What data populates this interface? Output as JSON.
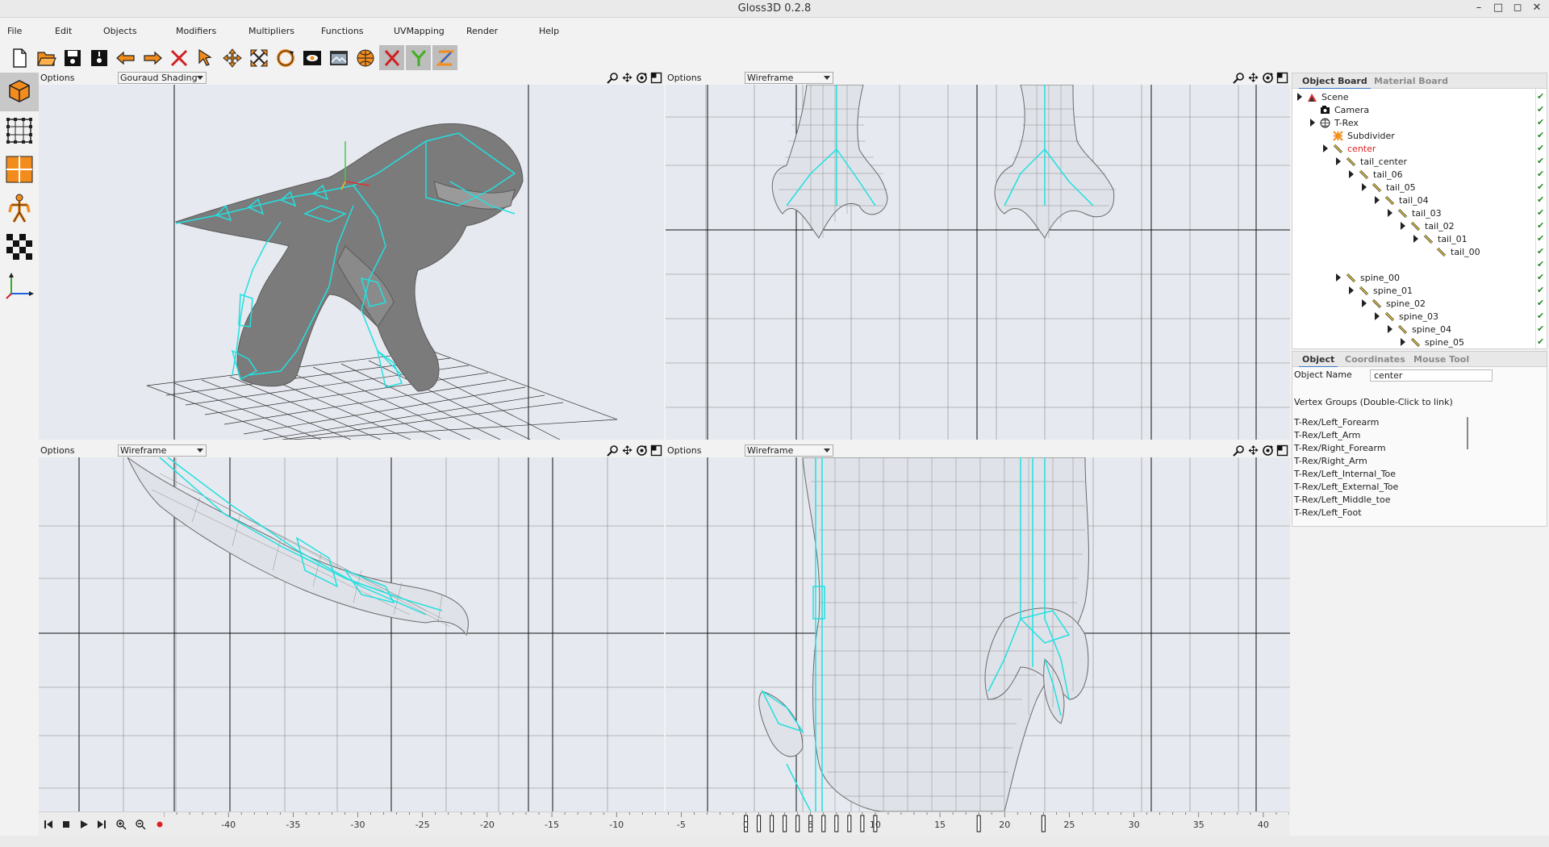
{
  "window": {
    "title": "Gloss3D 0.2.8",
    "controls": [
      "–",
      "□",
      "◻",
      "✕"
    ]
  },
  "menu": [
    "File",
    "Edit",
    "Objects",
    "Modifiers",
    "Multipliers",
    "Functions",
    "UVMapping",
    "Render",
    "Help"
  ],
  "toolbar_icons": [
    "new-file-icon",
    "open-file-icon",
    "save-icon",
    "save-as-icon",
    "undo-icon",
    "redo-icon",
    "delete-icon",
    "pick-arrow-icon",
    "move-icon",
    "scale-icon",
    "rotate-icon",
    "render-view-icon",
    "render-final-icon",
    "render-settings-icon",
    "axis-x-icon",
    "axis-y-icon",
    "axis-z-icon"
  ],
  "left_tools": [
    "object-mode-icon",
    "vertex-mode-icon",
    "face-mode-icon",
    "skin-mode-icon",
    "uv-mode-icon",
    "axis-mode-icon"
  ],
  "viewports": [
    {
      "options_label": "Options",
      "shading": "Gouraud Shading"
    },
    {
      "options_label": "Options",
      "shading": "Wireframe"
    },
    {
      "options_label": "Options",
      "shading": "Wireframe"
    },
    {
      "options_label": "Options",
      "shading": "Wireframe"
    }
  ],
  "object_board": {
    "tabs": [
      "Object Board",
      "Material Board"
    ],
    "active_tab": "Object Board",
    "tree": [
      {
        "label": "Scene",
        "depth": 0,
        "expandable": true,
        "icon": "scene-icon"
      },
      {
        "label": "Camera",
        "depth": 1,
        "expandable": false,
        "icon": "camera-icon"
      },
      {
        "label": "T-Rex",
        "depth": 1,
        "expandable": true,
        "icon": "mesh-icon"
      },
      {
        "label": "Subdivider",
        "depth": 2,
        "expandable": false,
        "icon": "subdivider-icon"
      },
      {
        "label": "center",
        "depth": 2,
        "expandable": true,
        "icon": "bone-icon",
        "selected": true
      },
      {
        "label": "tail_center",
        "depth": 3,
        "expandable": true,
        "icon": "bone-icon"
      },
      {
        "label": "tail_06",
        "depth": 4,
        "expandable": true,
        "icon": "bone-icon"
      },
      {
        "label": "tail_05",
        "depth": 5,
        "expandable": true,
        "icon": "bone-icon"
      },
      {
        "label": "tail_04",
        "depth": 6,
        "expandable": true,
        "icon": "bone-icon"
      },
      {
        "label": "tail_03",
        "depth": 7,
        "expandable": true,
        "icon": "bone-icon"
      },
      {
        "label": "tail_02",
        "depth": 8,
        "expandable": true,
        "icon": "bone-icon"
      },
      {
        "label": "tail_01",
        "depth": 9,
        "expandable": true,
        "icon": "bone-icon"
      },
      {
        "label": "tail_00",
        "depth": 10,
        "expandable": false,
        "icon": "bone-icon"
      },
      {
        "label": "spine_00",
        "depth": 3,
        "expandable": true,
        "icon": "bone-icon"
      },
      {
        "label": "spine_01",
        "depth": 4,
        "expandable": true,
        "icon": "bone-icon"
      },
      {
        "label": "spine_02",
        "depth": 5,
        "expandable": true,
        "icon": "bone-icon"
      },
      {
        "label": "spine_03",
        "depth": 6,
        "expandable": true,
        "icon": "bone-icon"
      },
      {
        "label": "spine_04",
        "depth": 7,
        "expandable": true,
        "icon": "bone-icon"
      },
      {
        "label": "spine_05",
        "depth": 8,
        "expandable": true,
        "icon": "bone-icon"
      },
      {
        "label": "spine_06",
        "depth": 9,
        "expandable": true,
        "icon": "bone-icon"
      }
    ]
  },
  "object_panel": {
    "tabs": [
      "Object",
      "Coordinates",
      "Mouse Tool"
    ],
    "active_tab": "Object",
    "object_name_label": "Object Name",
    "object_name_value": "center",
    "vertex_groups_label": "Vertex Groups (Double-Click to link)",
    "vertex_groups": [
      "T-Rex/Left_Forearm",
      "T-Rex/Left_Arm",
      "T-Rex/Right_Forearm",
      "T-Rex/Right_Arm",
      "T-Rex/Left_Internal_Toe",
      "T-Rex/Left_External_Toe",
      "T-Rex/Left_Middle_toe",
      "T-Rex/Left_Foot"
    ]
  },
  "timeline": {
    "buttons": [
      "go-start-icon",
      "stop-icon",
      "play-icon",
      "go-end-icon",
      "zoom-in-icon",
      "zoom-out-icon",
      "record-icon"
    ],
    "ticks": [
      "-40",
      "-35",
      "-30",
      "-25",
      "-20",
      "-15",
      "-10",
      "-5",
      "0",
      "5",
      "10",
      "15",
      "20",
      "25",
      "30",
      "35",
      "40"
    ],
    "keyframes": [
      0,
      1,
      2,
      3,
      4,
      5,
      6,
      7,
      8,
      9,
      10,
      18,
      23
    ]
  },
  "colors": {
    "bone": "#22e0e0",
    "selected": "#e02020",
    "check": "#2a8a2a",
    "accent": "#3a78c8",
    "toolbar_orange": "#f28c1c"
  }
}
